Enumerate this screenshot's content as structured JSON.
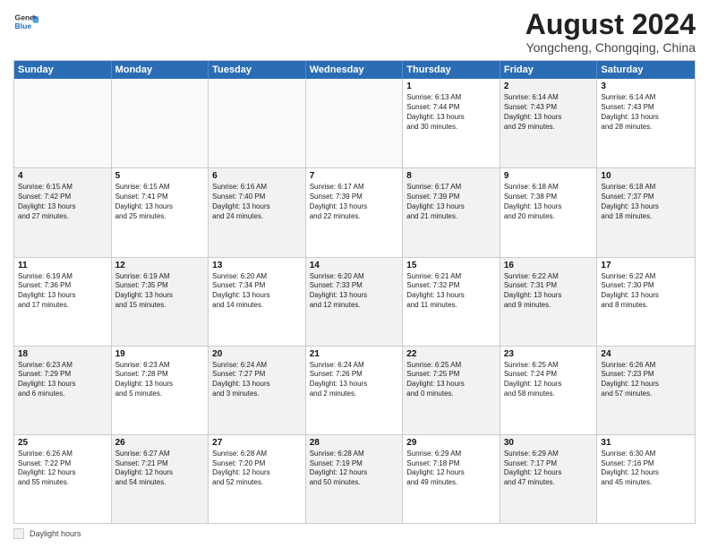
{
  "logo": {
    "line1": "General",
    "line2": "Blue"
  },
  "title": "August 2024",
  "location": "Yongcheng, Chongqing, China",
  "days_header": [
    "Sunday",
    "Monday",
    "Tuesday",
    "Wednesday",
    "Thursday",
    "Friday",
    "Saturday"
  ],
  "legend_label": "Daylight hours",
  "weeks": [
    [
      {
        "day": "",
        "info": "",
        "empty": true
      },
      {
        "day": "",
        "info": "",
        "empty": true
      },
      {
        "day": "",
        "info": "",
        "empty": true
      },
      {
        "day": "",
        "info": "",
        "empty": true
      },
      {
        "day": "1",
        "info": "Sunrise: 6:13 AM\nSunset: 7:44 PM\nDaylight: 13 hours\nand 30 minutes.",
        "empty": false
      },
      {
        "day": "2",
        "info": "Sunrise: 6:14 AM\nSunset: 7:43 PM\nDaylight: 13 hours\nand 29 minutes.",
        "empty": false,
        "alt": true
      },
      {
        "day": "3",
        "info": "Sunrise: 6:14 AM\nSunset: 7:43 PM\nDaylight: 13 hours\nand 28 minutes.",
        "empty": false
      }
    ],
    [
      {
        "day": "4",
        "info": "Sunrise: 6:15 AM\nSunset: 7:42 PM\nDaylight: 13 hours\nand 27 minutes.",
        "empty": false,
        "alt": true
      },
      {
        "day": "5",
        "info": "Sunrise: 6:15 AM\nSunset: 7:41 PM\nDaylight: 13 hours\nand 25 minutes.",
        "empty": false
      },
      {
        "day": "6",
        "info": "Sunrise: 6:16 AM\nSunset: 7:40 PM\nDaylight: 13 hours\nand 24 minutes.",
        "empty": false,
        "alt": true
      },
      {
        "day": "7",
        "info": "Sunrise: 6:17 AM\nSunset: 7:39 PM\nDaylight: 13 hours\nand 22 minutes.",
        "empty": false
      },
      {
        "day": "8",
        "info": "Sunrise: 6:17 AM\nSunset: 7:39 PM\nDaylight: 13 hours\nand 21 minutes.",
        "empty": false,
        "alt": true
      },
      {
        "day": "9",
        "info": "Sunrise: 6:18 AM\nSunset: 7:38 PM\nDaylight: 13 hours\nand 20 minutes.",
        "empty": false
      },
      {
        "day": "10",
        "info": "Sunrise: 6:18 AM\nSunset: 7:37 PM\nDaylight: 13 hours\nand 18 minutes.",
        "empty": false,
        "alt": true
      }
    ],
    [
      {
        "day": "11",
        "info": "Sunrise: 6:19 AM\nSunset: 7:36 PM\nDaylight: 13 hours\nand 17 minutes.",
        "empty": false
      },
      {
        "day": "12",
        "info": "Sunrise: 6:19 AM\nSunset: 7:35 PM\nDaylight: 13 hours\nand 15 minutes.",
        "empty": false,
        "alt": true
      },
      {
        "day": "13",
        "info": "Sunrise: 6:20 AM\nSunset: 7:34 PM\nDaylight: 13 hours\nand 14 minutes.",
        "empty": false
      },
      {
        "day": "14",
        "info": "Sunrise: 6:20 AM\nSunset: 7:33 PM\nDaylight: 13 hours\nand 12 minutes.",
        "empty": false,
        "alt": true
      },
      {
        "day": "15",
        "info": "Sunrise: 6:21 AM\nSunset: 7:32 PM\nDaylight: 13 hours\nand 11 minutes.",
        "empty": false
      },
      {
        "day": "16",
        "info": "Sunrise: 6:22 AM\nSunset: 7:31 PM\nDaylight: 13 hours\nand 9 minutes.",
        "empty": false,
        "alt": true
      },
      {
        "day": "17",
        "info": "Sunrise: 6:22 AM\nSunset: 7:30 PM\nDaylight: 13 hours\nand 8 minutes.",
        "empty": false
      }
    ],
    [
      {
        "day": "18",
        "info": "Sunrise: 6:23 AM\nSunset: 7:29 PM\nDaylight: 13 hours\nand 6 minutes.",
        "empty": false,
        "alt": true
      },
      {
        "day": "19",
        "info": "Sunrise: 6:23 AM\nSunset: 7:28 PM\nDaylight: 13 hours\nand 5 minutes.",
        "empty": false
      },
      {
        "day": "20",
        "info": "Sunrise: 6:24 AM\nSunset: 7:27 PM\nDaylight: 13 hours\nand 3 minutes.",
        "empty": false,
        "alt": true
      },
      {
        "day": "21",
        "info": "Sunrise: 6:24 AM\nSunset: 7:26 PM\nDaylight: 13 hours\nand 2 minutes.",
        "empty": false
      },
      {
        "day": "22",
        "info": "Sunrise: 6:25 AM\nSunset: 7:25 PM\nDaylight: 13 hours\nand 0 minutes.",
        "empty": false,
        "alt": true
      },
      {
        "day": "23",
        "info": "Sunrise: 6:25 AM\nSunset: 7:24 PM\nDaylight: 12 hours\nand 58 minutes.",
        "empty": false
      },
      {
        "day": "24",
        "info": "Sunrise: 6:26 AM\nSunset: 7:23 PM\nDaylight: 12 hours\nand 57 minutes.",
        "empty": false,
        "alt": true
      }
    ],
    [
      {
        "day": "25",
        "info": "Sunrise: 6:26 AM\nSunset: 7:22 PM\nDaylight: 12 hours\nand 55 minutes.",
        "empty": false
      },
      {
        "day": "26",
        "info": "Sunrise: 6:27 AM\nSunset: 7:21 PM\nDaylight: 12 hours\nand 54 minutes.",
        "empty": false,
        "alt": true
      },
      {
        "day": "27",
        "info": "Sunrise: 6:28 AM\nSunset: 7:20 PM\nDaylight: 12 hours\nand 52 minutes.",
        "empty": false
      },
      {
        "day": "28",
        "info": "Sunrise: 6:28 AM\nSunset: 7:19 PM\nDaylight: 12 hours\nand 50 minutes.",
        "empty": false,
        "alt": true
      },
      {
        "day": "29",
        "info": "Sunrise: 6:29 AM\nSunset: 7:18 PM\nDaylight: 12 hours\nand 49 minutes.",
        "empty": false
      },
      {
        "day": "30",
        "info": "Sunrise: 6:29 AM\nSunset: 7:17 PM\nDaylight: 12 hours\nand 47 minutes.",
        "empty": false,
        "alt": true
      },
      {
        "day": "31",
        "info": "Sunrise: 6:30 AM\nSunset: 7:16 PM\nDaylight: 12 hours\nand 45 minutes.",
        "empty": false
      }
    ]
  ]
}
